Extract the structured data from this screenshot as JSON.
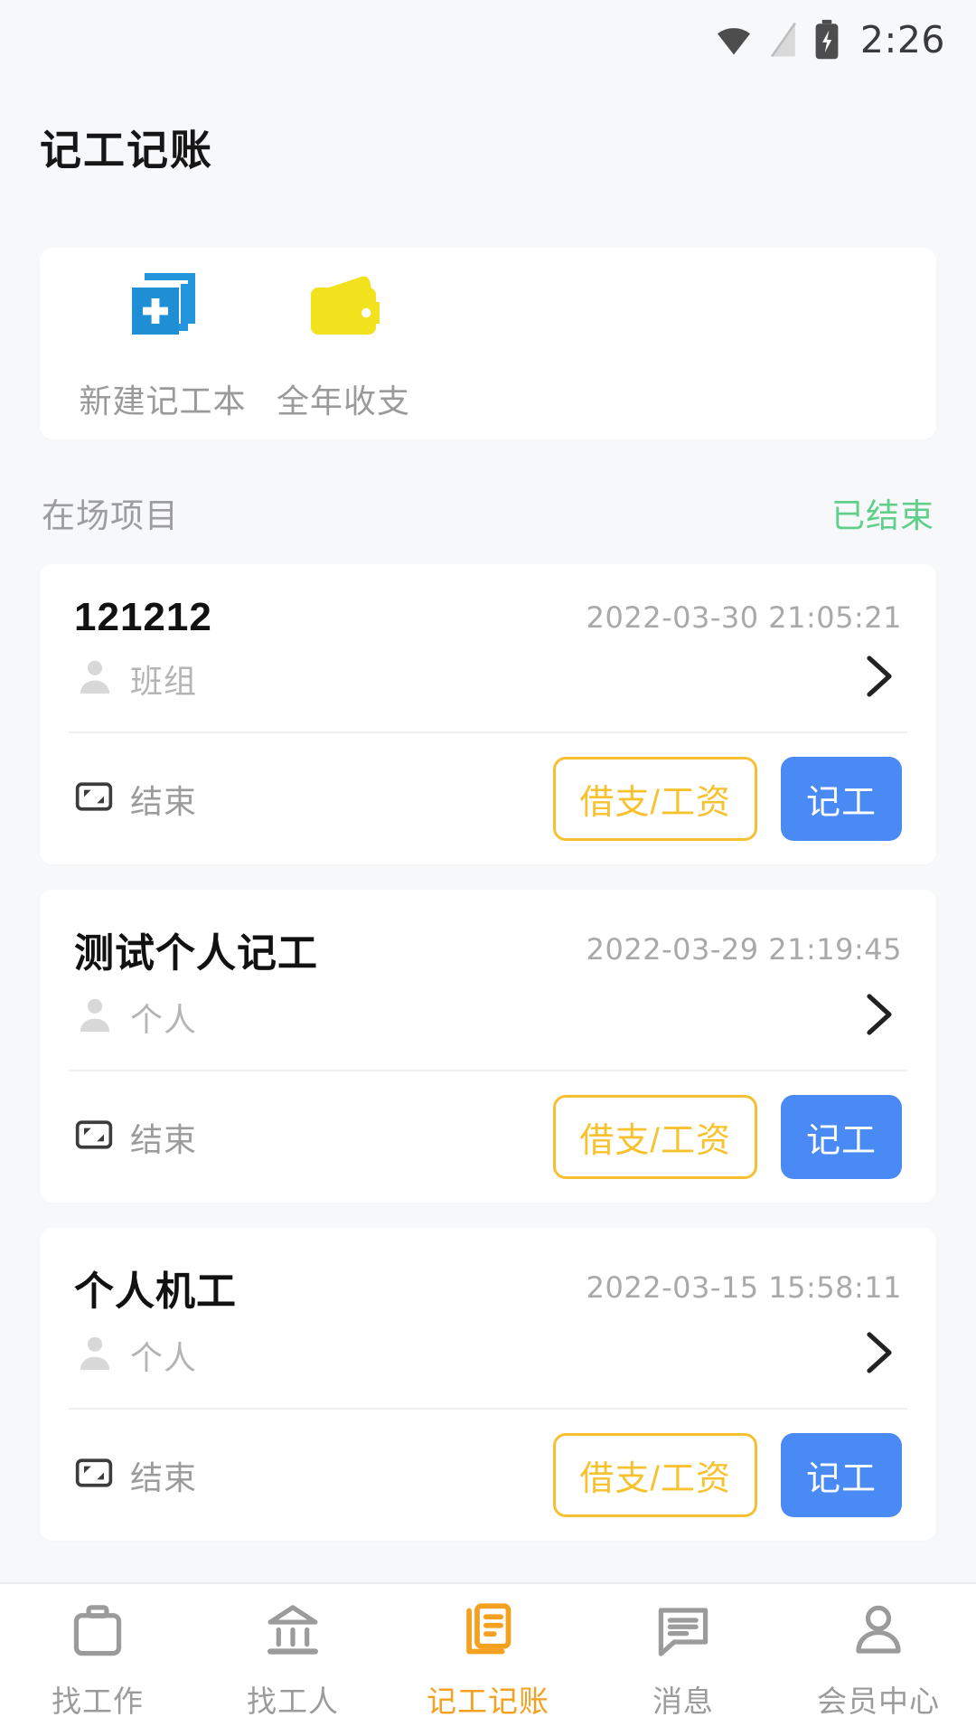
{
  "status_bar": {
    "time": "2:26",
    "icons": [
      "wifi-icon",
      "signal-icon",
      "battery-charging-icon"
    ]
  },
  "header": {
    "title": "记工记账"
  },
  "quick_actions": {
    "items": [
      {
        "label": "新建记工本",
        "icon": "new-notebook-icon",
        "color": "#2196dd"
      },
      {
        "label": "全年收支",
        "icon": "wallet-icon",
        "color": "#f2e21e"
      }
    ]
  },
  "section": {
    "title": "在场项目",
    "link_label": "已结束",
    "link_color": "#5fd08a"
  },
  "projects": [
    {
      "name": "121212",
      "date": "2022-03-30 21:05:21",
      "type": "班组",
      "end_label": "结束",
      "btn_outline": "借支/工资",
      "btn_fill": "记工"
    },
    {
      "name": "测试个人记工",
      "date": "2022-03-29 21:19:45",
      "type": "个人",
      "end_label": "结束",
      "btn_outline": "借支/工资",
      "btn_fill": "记工"
    },
    {
      "name": "个人机工",
      "date": "2022-03-15 15:58:11",
      "type": "个人",
      "end_label": "结束",
      "btn_outline": "借支/工资",
      "btn_fill": "记工"
    }
  ],
  "tabbar": {
    "active_index": 2,
    "active_color": "#f5a01e",
    "inactive_color": "#9b9b9b",
    "items": [
      {
        "label": "找工作",
        "icon": "briefcase-icon"
      },
      {
        "label": "找工人",
        "icon": "bank-icon"
      },
      {
        "label": "记工记账",
        "icon": "ledger-icon"
      },
      {
        "label": "消息",
        "icon": "chat-icon"
      },
      {
        "label": "会员中心",
        "icon": "person-icon"
      }
    ]
  },
  "theme": {
    "page_bg": "#f7f8fa",
    "card_bg": "#ffffff",
    "accent_blue": "#4a8af4",
    "accent_yellow": "#f7c033",
    "accent_orange": "#f5a01e",
    "accent_green": "#5fd08a"
  }
}
